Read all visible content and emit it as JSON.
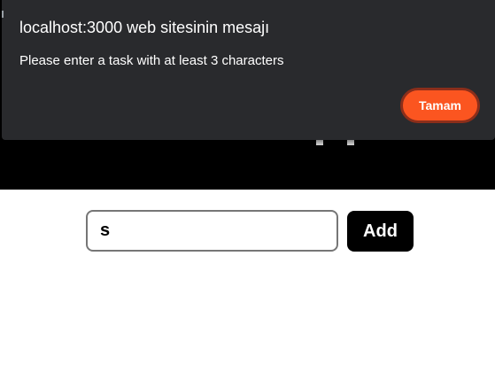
{
  "dialog": {
    "title": "localhost:3000 web sitesinin mesajı",
    "message": "Please enter a task with at least 3 characters",
    "ok_label": "Tamam",
    "ok_color": "#fb5520",
    "background_color": "#292a2d"
  },
  "form": {
    "input_value": "s",
    "add_label": "Add"
  },
  "colors": {
    "header_background": "#000000",
    "page_background": "#ffffff",
    "button_background": "#000000"
  }
}
